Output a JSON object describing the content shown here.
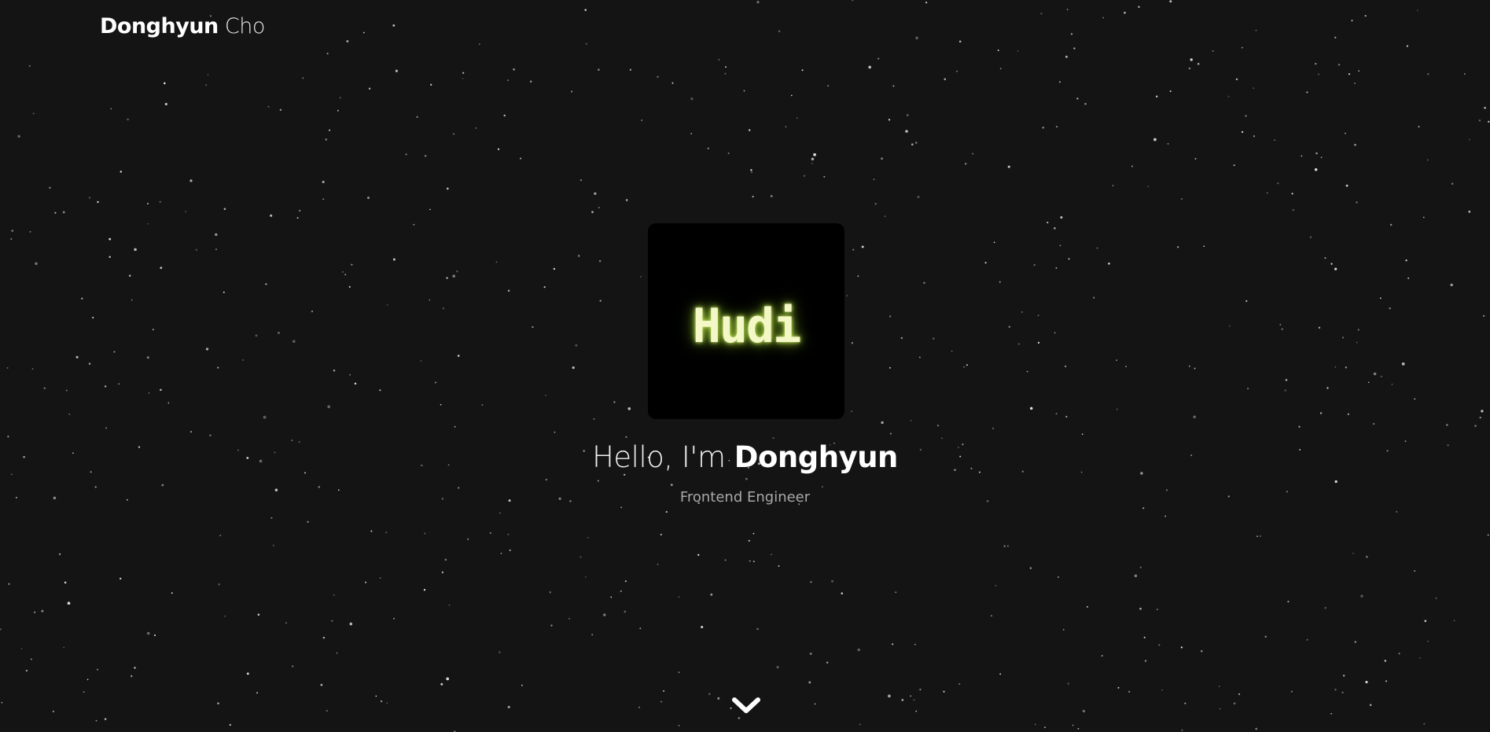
{
  "header": {
    "brand_first": "Donghyun",
    "brand_last": "Cho"
  },
  "hero": {
    "logo_text": "Hudi",
    "greeting_prefix": "Hello, I'm",
    "greeting_name": "Donghyun",
    "subtitle": "Frontend Engineer"
  },
  "icons": {
    "scroll": "chevron-down-icon"
  },
  "colors": {
    "background": "#141414",
    "logo_box": "#000000",
    "logo_glow": "#c8e26a",
    "subtitle": "#a8a8a8",
    "star": "#ffffff"
  }
}
